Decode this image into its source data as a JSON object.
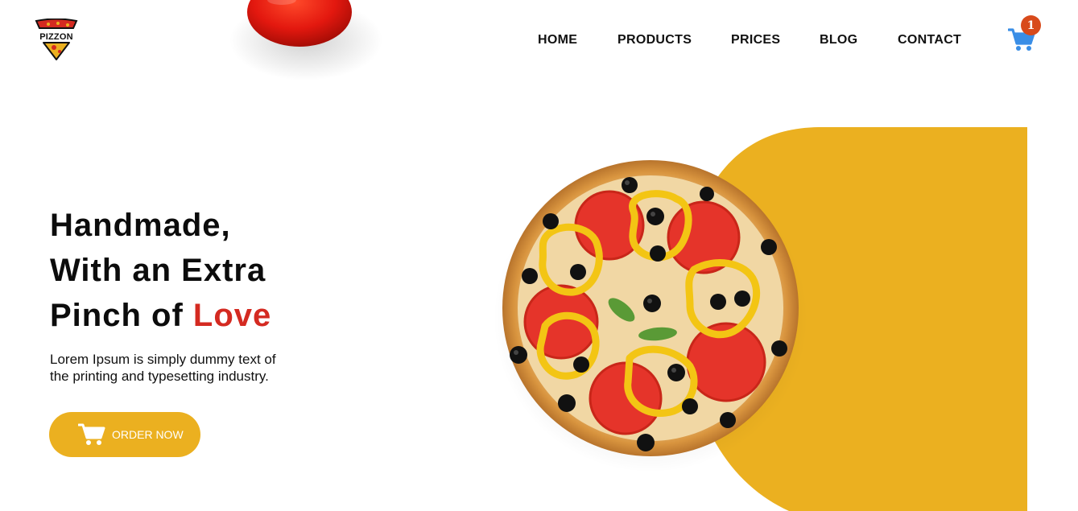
{
  "brand": {
    "logo_text": "PIZZON"
  },
  "nav": {
    "items": [
      {
        "label": "HOME"
      },
      {
        "label": "PRODUCTS"
      },
      {
        "label": "PRICES"
      },
      {
        "label": "BLOG"
      },
      {
        "label": "CONTACT"
      }
    ]
  },
  "cart": {
    "count": "1",
    "icon": "cart-icon"
  },
  "hero": {
    "headline_line1": "Handmade,",
    "headline_line2": "With an Extra",
    "headline_line3_start": "Pinch of ",
    "headline_highlight": "Love",
    "description": "Lorem Ipsum is simply dummy text of the printing and typesetting industry.",
    "cta_label": "ORDER NOW"
  },
  "colors": {
    "accent_yellow": "#ebb020",
    "highlight_red": "#d42a21",
    "badge_red": "#d84a1b",
    "cart_blue": "#3a8ee6"
  }
}
